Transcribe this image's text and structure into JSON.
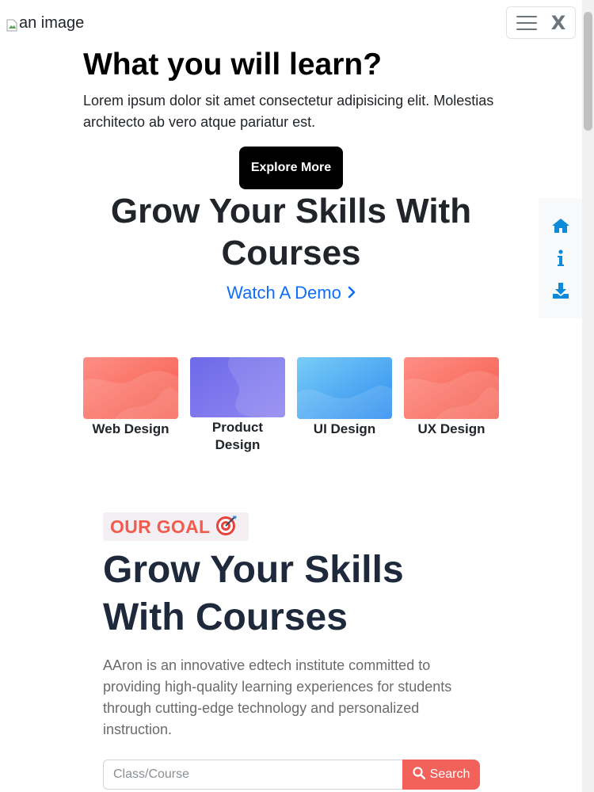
{
  "header": {
    "logo_alt": "an image",
    "close_label": "X",
    "hamburger_icon": "hamburger-menu-icon"
  },
  "hero": {
    "title": "What you will learn?",
    "description": "Lorem ipsum dolor sit amet consectetur adipisicing elit. Molestias architecto ab vero atque pariatur est.",
    "button_label": "Explore More"
  },
  "grow": {
    "title": "Grow Your Skills With Courses",
    "watch_demo": "Watch A Demo",
    "watch_demo_icon": "chevron-right-icon",
    "link_color": "#0d6efd"
  },
  "side_nav": {
    "icons": [
      "home-icon",
      "info-icon",
      "download-icon"
    ],
    "icon_color": "#0d8bd8"
  },
  "courses": [
    {
      "label": "Web Design",
      "color": "#f76b5c"
    },
    {
      "label": "Product Design",
      "color": "#7d74ee"
    },
    {
      "label": "UI Design",
      "color": "#4daeee"
    },
    {
      "label": "UX Design",
      "color": "#f76b5c"
    }
  ],
  "goal": {
    "badge_text": "OUR GOAL",
    "badge_icon": "target-icon",
    "title": "Grow Your Skills With Courses",
    "description": "AAron is an innovative edtech institute committed to providing high-quality learning experiences for students through cutting-edge technology and personalized instruction.",
    "accent_color": "#f25c4e"
  },
  "search": {
    "placeholder": "Class/Course",
    "value": "",
    "button_label": "Search",
    "button_icon": "search-icon"
  }
}
